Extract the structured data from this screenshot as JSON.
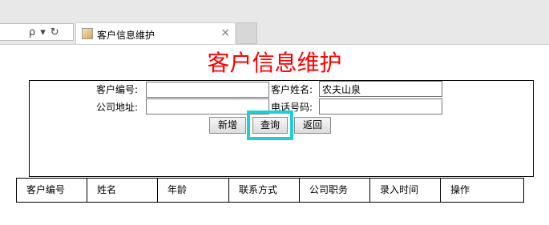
{
  "browser": {
    "tab_title": "客户信息维护",
    "close_glyph": "×",
    "search_glyph": "ρ",
    "dropdown_glyph": "▾",
    "refresh_glyph": "↻"
  },
  "page": {
    "title": "客户信息维护",
    "title_color": "#ff0000"
  },
  "form": {
    "customer_id_label": "客户编号:",
    "customer_id_value": "",
    "customer_name_label": "客户姓名:",
    "customer_name_value": "农夫山泉",
    "address_label": "公司地址:",
    "address_value": "",
    "phone_label": "电话号码:",
    "phone_value": ""
  },
  "buttons": {
    "add": "新增",
    "query": "查询",
    "back": "返回"
  },
  "highlight_color": "#1ecfd6",
  "table": {
    "columns": [
      "客户编号",
      "姓名",
      "年龄",
      "联系方式",
      "公司职务",
      "录入时间",
      "操作"
    ]
  }
}
